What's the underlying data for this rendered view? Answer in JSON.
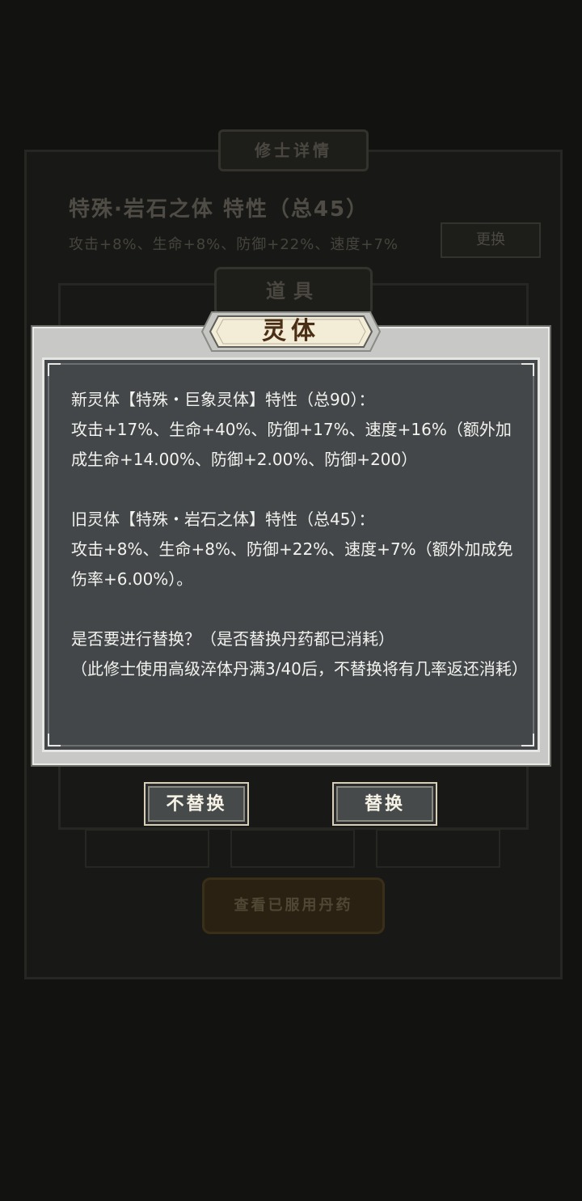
{
  "background": {
    "title": "修士详情",
    "line1": "特殊·岩石之体 特性（总45）",
    "line2": "攻击+8%、生命+8%、防御+22%、速度+7%",
    "side_button": "更换",
    "tab": "道具",
    "view_button": "查看已服用丹药"
  },
  "dialog": {
    "title": "灵体",
    "new_header": "新灵体【特殊・巨象灵体】特性（总90）：",
    "new_stats": "攻击+17%、生命+40%、防御+17%、速度+16%（额外加成生命+14.00%、防御+2.00%、防御+200）",
    "old_header": "旧灵体【特殊・岩石之体】特性（总45）：",
    "old_stats": "攻击+8%、生命+8%、防御+22%、速度+7%（额外加成免伤率+6.00%）。",
    "question": "是否要进行替换？（是否替换丹药都已消耗）",
    "note": "（此修士使用高级淬体丹满3/40后，不替换将有几率返还消耗）",
    "cancel_label": "不替换",
    "confirm_label": "替换"
  },
  "colors": {
    "content_bg": "#434749",
    "modal_bg": "#c8c8c6",
    "title_text": "#4a2e16",
    "body_text": "#f2f2ee"
  }
}
